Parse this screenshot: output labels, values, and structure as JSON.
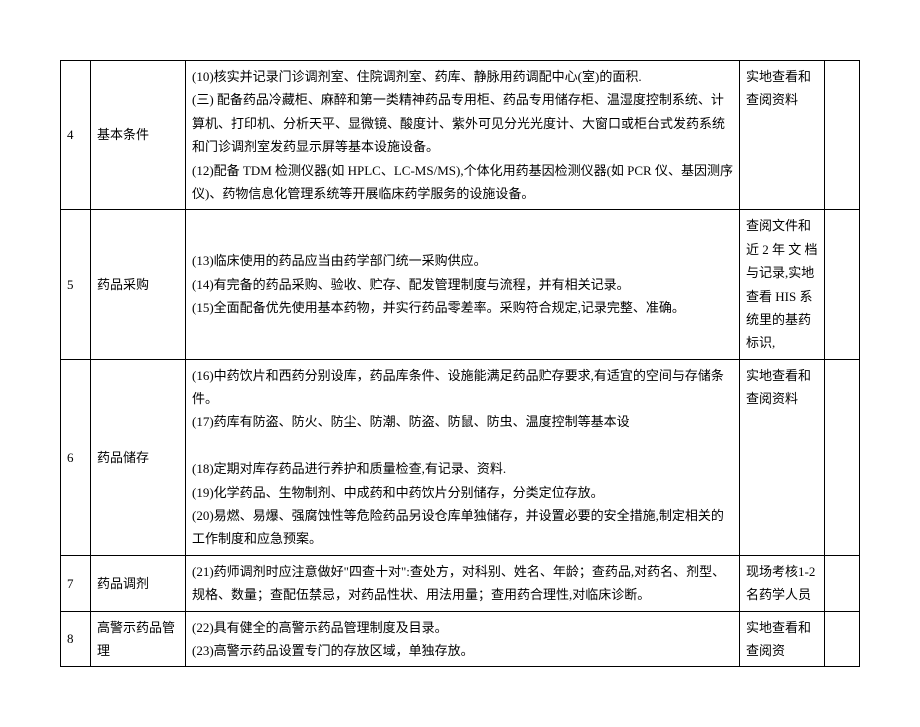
{
  "rows": [
    {
      "num": "4",
      "category": "基本条件",
      "content_lines": [
        "    (10)核实并记录门诊调剂室、住院调剂室、药库、静脉用药调配中心(室)的面积.",
        "    (三) 配备药品冷藏柜、麻醉和第一类精神药品专用柜、药品专用储存柜、温湿度控制系统、计算机、打印机、分析天平、显微镜、酸度计、紫外可见分光光度计、大窗口或柜台式发药系统和门诊调剂室发药显示屏等基本设施设备。",
        "    (12)配备 TDM 检测仪器(如 HPLC、LC-MS/MS),个体化用药基因检测仪器(如 PCR 仪、基因测序仪)、药物信息化管理系统等开展临床药学服务的设施设备。"
      ],
      "note": "实地查看和查阅资料"
    },
    {
      "num": "5",
      "category": "药品采购",
      "content_lines": [
        "",
        "    (13)临床使用的药品应当由药学部门统一采购供应。",
        "    (14)有完备的药品采购、验收、贮存、配发管理制度与流程，并有相关记录。",
        "    (15)全面配备优先使用基本药物，并实行药品零差率。采购符合规定,记录完整、准确。",
        ""
      ],
      "note": "查阅文件和近 2 年 文 档与记录,实地查看 HIS 系统里的基药标识,"
    },
    {
      "num": "6",
      "category": "药品储存",
      "content_lines": [
        "    (16)中药饮片和西药分别设库，药品库条件、设施能满足药品贮存要求,有适宜的空间与存储条件。",
        "    (17)药库有防盗、防火、防尘、防潮、防盗、防鼠、防虫、温度控制等基本设",
        "",
        "    (18)定期对库存药品进行养护和质量检查,有记录、资料.",
        "    (19)化学药品、生物制剂、中成药和中药饮片分别储存，分类定位存放。",
        "    (20)易燃、易爆、强腐蚀性等危险药品另设仓库单独储存，并设置必要的安全措施,制定相关的工作制度和应急预案。"
      ],
      "note": "实地查看和查阅资料"
    },
    {
      "num": "7",
      "category": "药品调剂",
      "content_lines": [
        "    (21)药师调剂时应注意做好\"四查十对\":查处方，对科别、姓名、年龄；查药品,对药名、剂型、规格、数量；查配伍禁忌，对药品性状、用法用量；查用药合理性,对临床诊断。"
      ],
      "note": "现场考核1-2 名药学人员"
    },
    {
      "num": "8",
      "category": "高警示药品管理",
      "content_lines": [
        "    (22)具有健全的高警示药品管理制度及目录。",
        "    (23)高警示药品设置专门的存放区域，单独存放。"
      ],
      "note": "实地查看和查阅资"
    }
  ]
}
